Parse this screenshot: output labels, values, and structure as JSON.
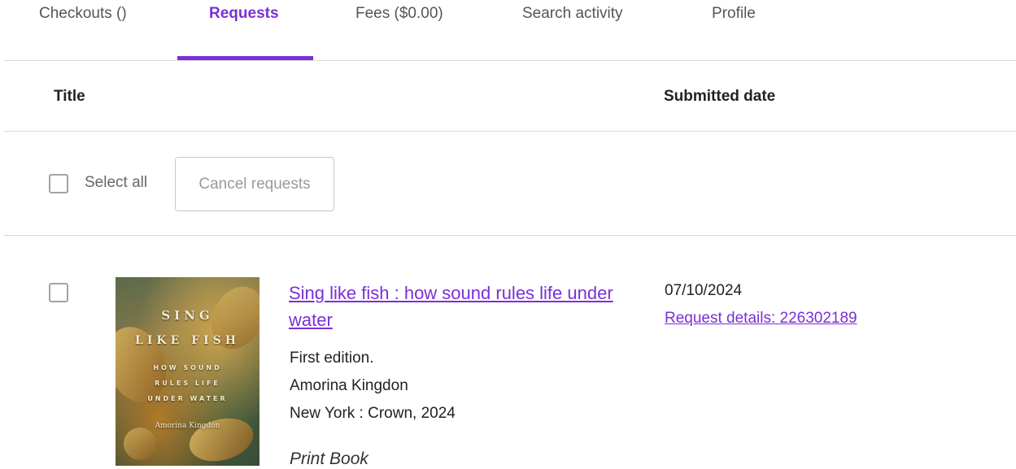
{
  "tabs": [
    {
      "label": "Checkouts ()"
    },
    {
      "label": "Requests",
      "active": true
    },
    {
      "label": "Fees ($0.00)"
    },
    {
      "label": "Search activity"
    },
    {
      "label": "Profile"
    }
  ],
  "table": {
    "col_title": "Title",
    "col_submitted": "Submitted date"
  },
  "actions": {
    "select_all_label": "Select all",
    "cancel_button": "Cancel requests"
  },
  "items": [
    {
      "title": "Sing like fish : how sound rules life under water",
      "edition": "First edition.",
      "author": "Amorina Kingdon",
      "publisher": "New York : Crown, 2024",
      "format": "Print Book",
      "submitted_date": "07/10/2024",
      "request_details": "Request details: 226302189",
      "cover": {
        "title_line1": "SING",
        "title_line2": "LIKE FISH",
        "subtitle_line1": "HOW SOUND",
        "subtitle_line2": "RULES LIFE",
        "subtitle_line3": "UNDER WATER",
        "author": "Amorina Kingdon"
      }
    }
  ],
  "colors": {
    "accent": "#7b2fd6",
    "rule": "#d9d9d9"
  }
}
